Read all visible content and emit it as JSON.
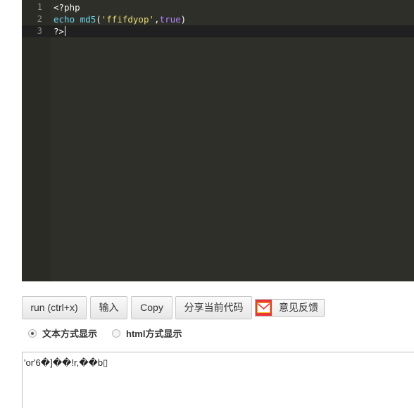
{
  "editor": {
    "lines": [
      {
        "number": "1",
        "tokens": [
          {
            "text": "<?php",
            "cls": "c-tag"
          }
        ]
      },
      {
        "number": "2",
        "tokens": [
          {
            "text": "echo ",
            "cls": "c-kw"
          },
          {
            "text": "md5",
            "cls": "c-kw"
          },
          {
            "text": "(",
            "cls": "c-pun"
          },
          {
            "text": "'ffifdyop'",
            "cls": "c-str"
          },
          {
            "text": ",",
            "cls": "c-pun"
          },
          {
            "text": "true",
            "cls": "c-lit"
          },
          {
            "text": ")",
            "cls": "c-pun"
          }
        ]
      },
      {
        "number": "3",
        "tokens": [
          {
            "text": "?>",
            "cls": "c-tag"
          }
        ]
      }
    ],
    "active_line": 3
  },
  "toolbar": {
    "run_label": "run (ctrl+x)",
    "input_label": "输入",
    "copy_label": "Copy",
    "share_label": "分享当前代码",
    "feedback_label": "意见反馈",
    "feedback_icon": "mail-icon"
  },
  "display_mode": {
    "options": [
      {
        "label": "文本方式显示",
        "checked": true
      },
      {
        "label": "html方式显示",
        "checked": false
      }
    ]
  },
  "output": {
    "text": "'or'6�]��!r,��b▯"
  }
}
